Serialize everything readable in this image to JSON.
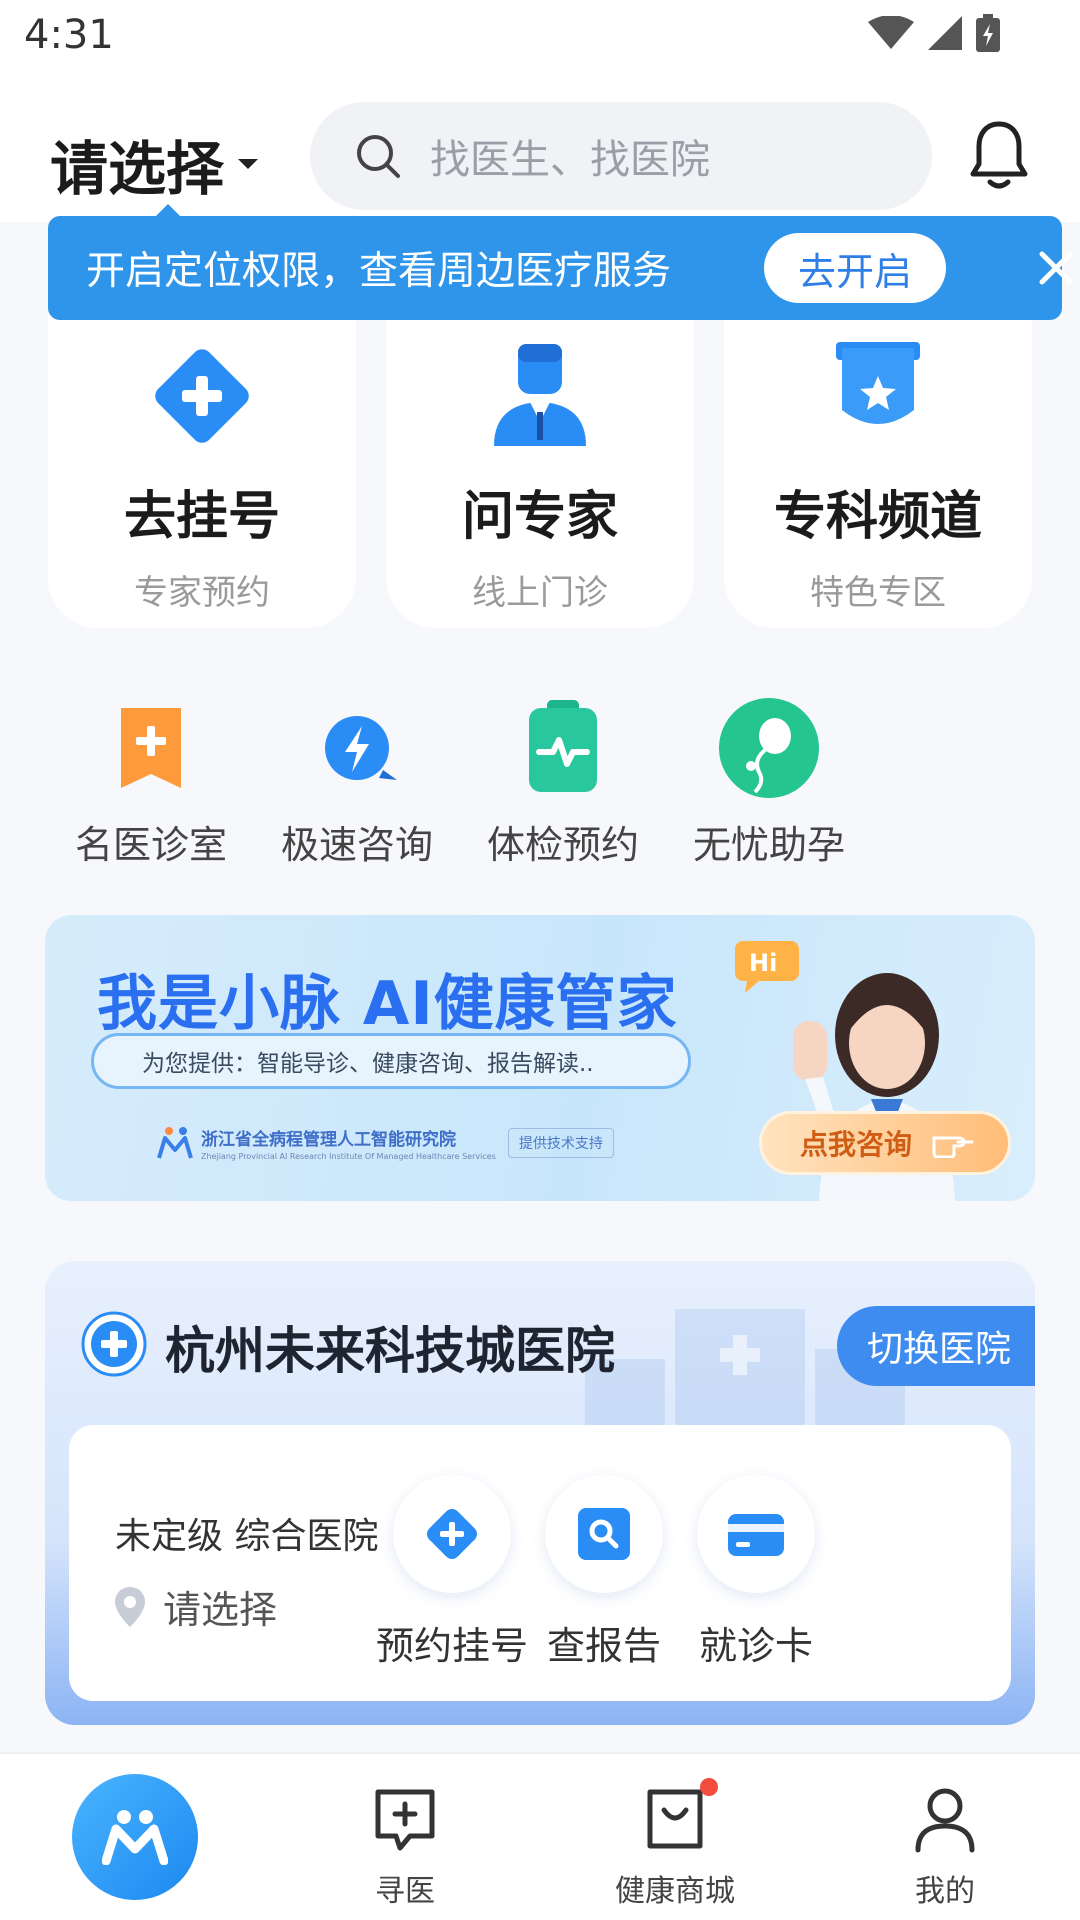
{
  "status_bar": {
    "time": "4:31"
  },
  "header": {
    "city_label": "请选择",
    "search_placeholder": "找医生、找医院"
  },
  "location_banner": {
    "text": "开启定位权限，查看周边医疗服务",
    "button_label": "去开启"
  },
  "main_cards": [
    {
      "title": "去挂号",
      "subtitle": "专家预约",
      "icon": "plus-diamond-icon"
    },
    {
      "title": "问专家",
      "subtitle": "线上门诊",
      "icon": "doctor-icon"
    },
    {
      "title": "专科频道",
      "subtitle": "特色专区",
      "icon": "star-badge-icon"
    }
  ],
  "quick_services": [
    {
      "label": "名医诊室",
      "icon": "bookmark-plus-icon"
    },
    {
      "label": "极速咨询",
      "icon": "lightning-chat-icon"
    },
    {
      "label": "体检预约",
      "icon": "clipboard-pulse-icon"
    },
    {
      "label": "无忧助孕",
      "icon": "fertility-icon"
    }
  ],
  "ai_banner": {
    "title": "我是小脉 AI健康管家",
    "subtitle": "为您提供：智能导诊、健康咨询、报告解读..",
    "org_name": "浙江省全病程管理人工智能研究院",
    "org_name_en": "Zhejiang Provincial AI Research Institute Of Managed Healthcare Services",
    "tech_support": "提供技术支持",
    "hi": "Hi",
    "cta_label": "点我咨询"
  },
  "hospital": {
    "name": "杭州未来科技城医院",
    "switch_label": "切换医院",
    "level": "未定级 综合医院",
    "location": "请选择",
    "actions": [
      {
        "label": "预约挂号",
        "icon": "register-icon"
      },
      {
        "label": "查报告",
        "icon": "report-search-icon"
      },
      {
        "label": "就诊卡",
        "icon": "card-icon"
      }
    ]
  },
  "bottom_nav": {
    "items": [
      {
        "label": "寻医",
        "icon": "chat-plus-icon"
      },
      {
        "label": "健康商城",
        "icon": "shopping-bag-icon"
      },
      {
        "label": "我的",
        "icon": "user-icon"
      }
    ]
  }
}
